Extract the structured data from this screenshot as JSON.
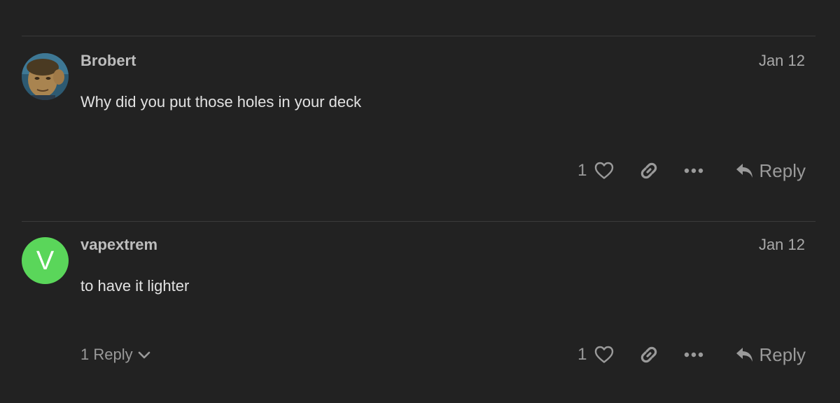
{
  "posts": [
    {
      "username": "Brobert",
      "date": "Jan 12",
      "text": "Why did you put those holes in your deck",
      "like_count": "1",
      "reply_label": "Reply",
      "avatar_type": "photo"
    },
    {
      "username": "vapextrem",
      "date": "Jan 12",
      "text": "to have it lighter",
      "like_count": "1",
      "reply_label": "Reply",
      "avatar_type": "letter",
      "avatar_letter": "V",
      "avatar_color": "#5ad65a",
      "replies_toggle_label": "1 Reply"
    }
  ],
  "icons": {
    "like": "heart-icon",
    "link": "link-icon",
    "more": "more-icon",
    "reply": "reply-icon",
    "expand": "chevron-down-icon"
  },
  "colors": {
    "background": "#222222",
    "text": "#e2e2e2",
    "muted": "#9a9a9a"
  }
}
